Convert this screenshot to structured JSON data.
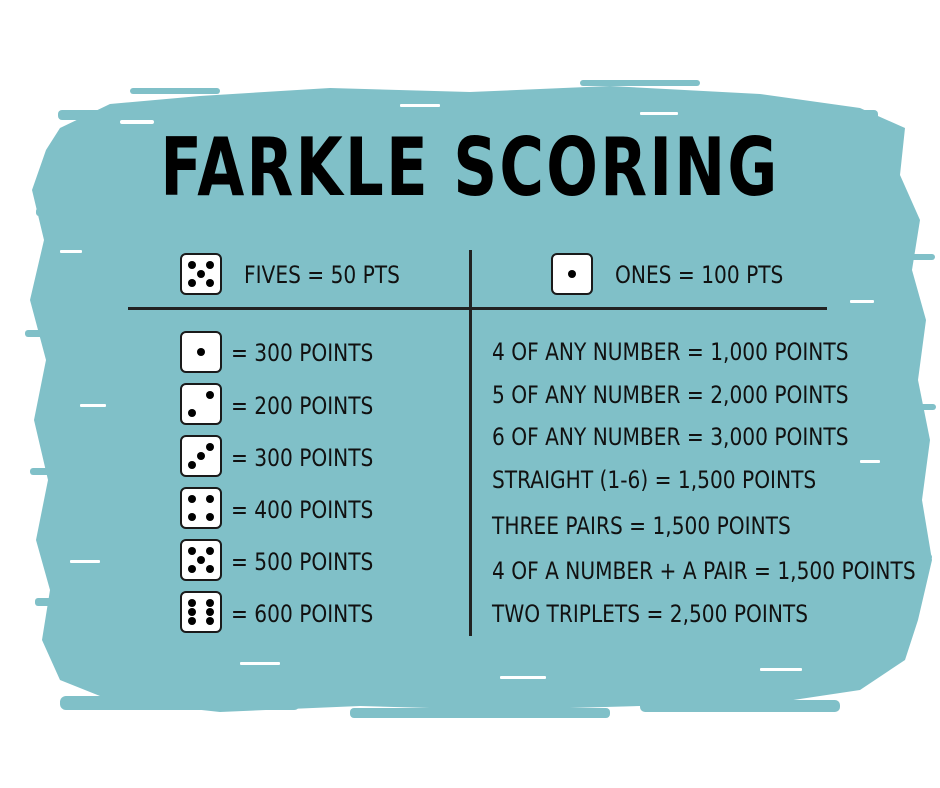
{
  "title": "FARKLE SCORING",
  "colors": {
    "brush": "#80c0c8",
    "background": "#ffffff",
    "text": "#111111"
  },
  "header": {
    "fives": {
      "die_face": 5,
      "label": "FIVES = 50 PTS"
    },
    "ones": {
      "die_face": 1,
      "label": "ONES = 100 PTS"
    }
  },
  "triples": [
    {
      "die_face": 1,
      "label": "= 300 POINTS"
    },
    {
      "die_face": 2,
      "label": "= 200 POINTS"
    },
    {
      "die_face": 3,
      "label": "= 300 POINTS"
    },
    {
      "die_face": 4,
      "label": "= 400 POINTS"
    },
    {
      "die_face": 5,
      "label": "= 500 POINTS"
    },
    {
      "die_face": 6,
      "label": "= 600 POINTS"
    }
  ],
  "combos": [
    "4 OF ANY NUMBER = 1,000 POINTS",
    "5 OF ANY NUMBER = 2,000 POINTS",
    "6 OF ANY NUMBER = 3,000 POINTS",
    "STRAIGHT (1-6) = 1,500 POINTS",
    "THREE PAIRS = 1,500 POINTS",
    "4 OF A NUMBER + A PAIR = 1,500 POINTS",
    "TWO TRIPLETS = 2,500 POINTS"
  ]
}
